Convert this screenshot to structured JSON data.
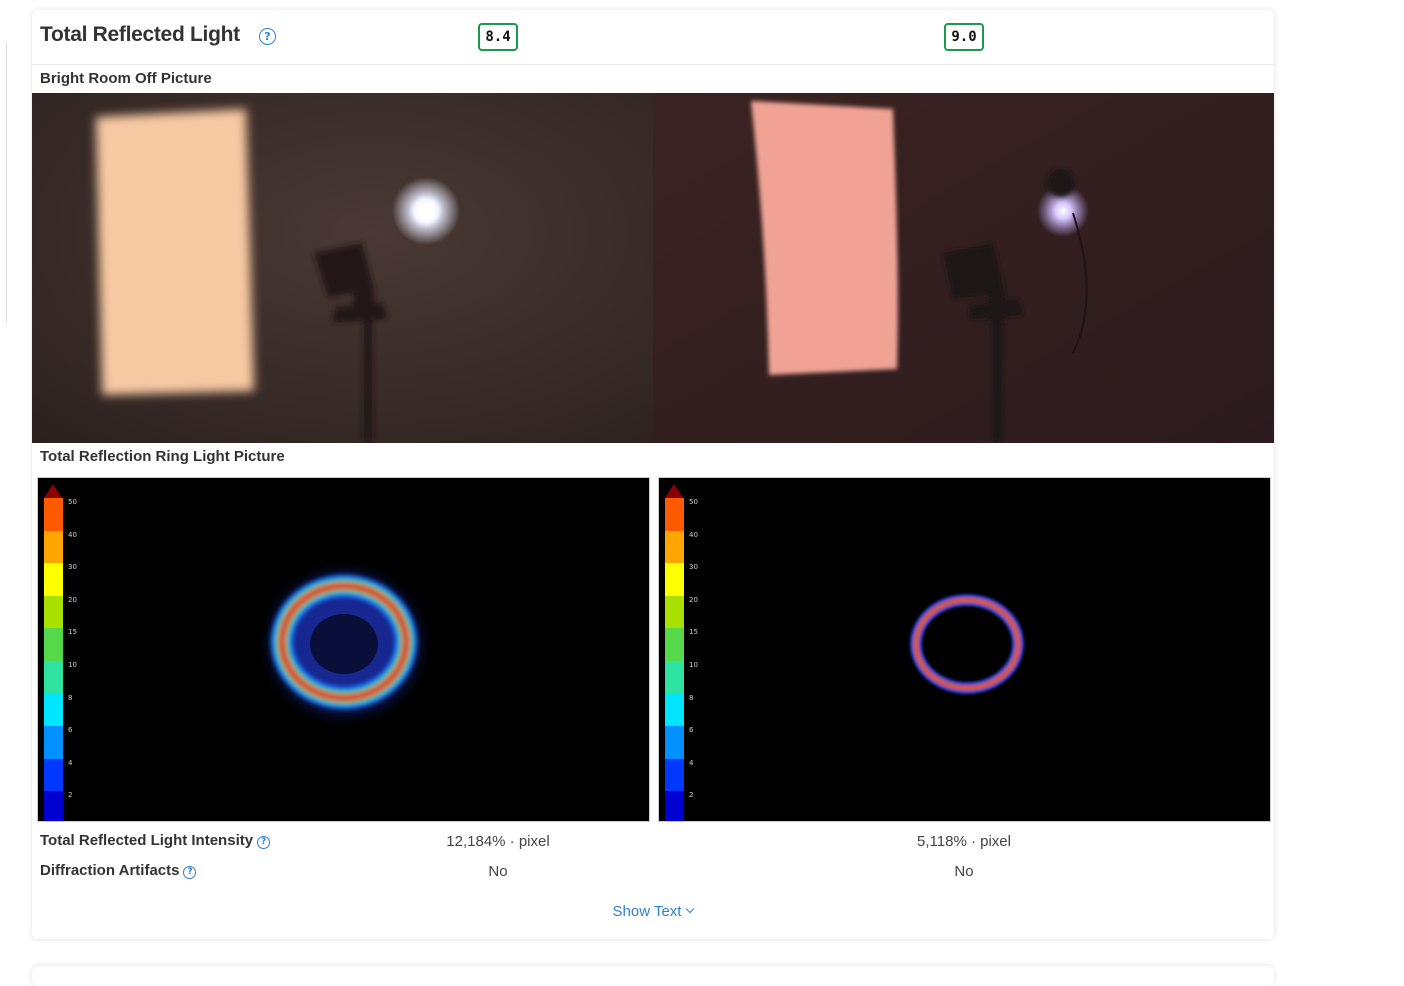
{
  "section": {
    "title": "Total Reflected Light",
    "help_icon": "question-circle-icon",
    "scores": [
      "8.4",
      "9.0"
    ],
    "score_color": "#1a9a4e",
    "accent_color": "#2f7fd0"
  },
  "bright_room": {
    "label": "Bright Room Off Picture"
  },
  "ring_light": {
    "label": "Total Reflection Ring Light Picture",
    "colorbar_ticks": [
      "50",
      "40",
      "30",
      "20",
      "15",
      "10",
      "8",
      "6",
      "4",
      "2"
    ],
    "colorbar_colors": [
      "#ff5a00",
      "#ffa500",
      "#ffff00",
      "#a8e000",
      "#55d84a",
      "#2ee3a0",
      "#00e5ff",
      "#0090ff",
      "#0038ff",
      "#0000d0"
    ]
  },
  "metrics": [
    {
      "label": "Total Reflected Light Intensity",
      "values": [
        "12,184% · pixel",
        "5,118% · pixel"
      ]
    },
    {
      "label": "Diffraction Artifacts",
      "values": [
        "No",
        "No"
      ]
    }
  ],
  "footer": {
    "show_text": "Show Text",
    "chevron_icon": "chevron-down-icon"
  }
}
